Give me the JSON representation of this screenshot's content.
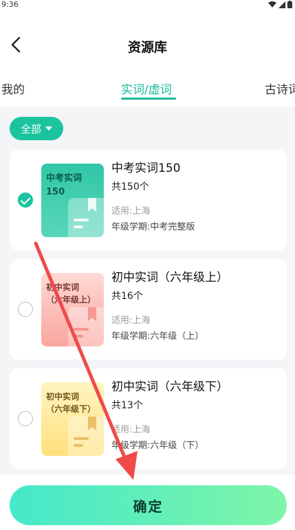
{
  "status_bar": {
    "time": "9:36"
  },
  "nav": {
    "title": "资源库"
  },
  "tabs": [
    {
      "label": "我的",
      "active": false
    },
    {
      "label": "实词/虚词",
      "active": true
    },
    {
      "label": "古诗词",
      "active": false
    }
  ],
  "filter": {
    "label": "全部"
  },
  "cards": [
    {
      "title": "中考实词150",
      "count": "共150个",
      "region": "适用:上海",
      "grade": "年级学期:中考完整版",
      "cover_text": "中考实词\n150",
      "cover_color": "green",
      "selected": true
    },
    {
      "title": "初中实词（六年级上）",
      "count": "共16个",
      "region": "适用:上海",
      "grade": "年级学期:六年级（上）",
      "cover_text": "初中实词\n（六年级上）",
      "cover_color": "red",
      "selected": false
    },
    {
      "title": "初中实词（六年级下）",
      "count": "共13个",
      "region": "适用:上海",
      "grade": "年级学期:六年级（下）",
      "cover_text": "初中实词\n（六年级下）",
      "cover_color": "yellow",
      "selected": false
    }
  ],
  "confirm": {
    "label": "确定"
  },
  "colors": {
    "accent": "#1bb99a",
    "arrow": "#f04a4a"
  }
}
